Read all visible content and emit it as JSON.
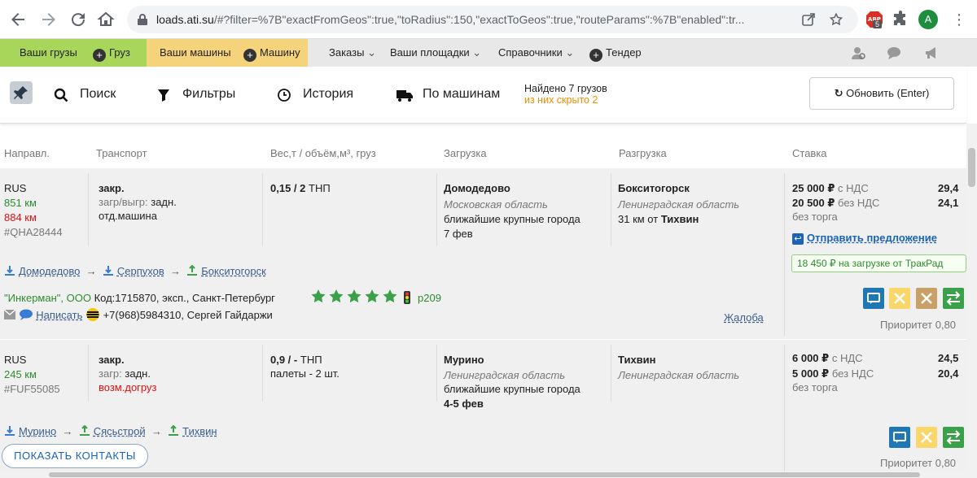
{
  "browser": {
    "url_host": "loads.ati.su",
    "url_rest": "/#?filter=%7B\"exactFromGeos\":true,\"toRadius\":150,\"exactToGeos\":true,\"routeParams\":%7B\"enabled\":tr...",
    "ext_badge": "5",
    "avatar_letter": "A"
  },
  "topmenu": {
    "my_cargo": "Ваши грузы",
    "add_cargo": "Груз",
    "my_trucks": "Ваши машины",
    "add_truck": "Машину",
    "orders": "Заказы",
    "platforms": "Ваши площадки",
    "directories": "Справочники",
    "tender": "Тендер"
  },
  "toolbar": {
    "search": "Поиск",
    "filters": "Фильтры",
    "history": "История",
    "by_trucks": "По машинам",
    "found": "Найдено 7 грузов",
    "hidden": "из них скрыто 2",
    "refresh": "Обновить (Enter)"
  },
  "columns": {
    "direction": "Направл.",
    "transport": "Транспорт",
    "weight": "Вес,т / объём,м³, груз",
    "loading": "Загрузка",
    "unloading": "Разгрузка",
    "rate": "Ставка"
  },
  "rows": [
    {
      "country": "RUS",
      "dist1": "851 км",
      "dist2": "884 км",
      "id": "#QHA28444",
      "body": "закр.",
      "load_label": "загр/выгр:",
      "load_value": "задн.",
      "extra": "отд.машина",
      "weight": "0,15 / 2",
      "cargo": "ТНП",
      "from_city": "Домодедово",
      "from_region": "Московская область",
      "from_near": "ближайшие крупные города",
      "from_date": "7 фев",
      "to_city": "Бокситогорск",
      "to_region": "Ленинградская область",
      "to_dist": "31 км от",
      "to_dist_city": "Тихвин",
      "rate_vat": "25 000 ₽",
      "rate_vat_label": "с НДС",
      "rate_novat": "20 500 ₽",
      "rate_novat_label": "без НДС",
      "no_bargain": "без торга",
      "rate_per_km1": "29,4",
      "rate_per_km2": "24,1",
      "send_offer": "Отправить предложение",
      "trakrad": "18 450 ₽ на загрузке от ТракРад",
      "route1": "Домодедово",
      "route2": "Серпухов",
      "route3": "Бокситогорск",
      "company": "\"Инкерман\", ООО",
      "company_info": "Код:1715870, эксп., Санкт-Петербург",
      "rating_stars": 5,
      "company_score": "р209",
      "write": "Написать",
      "phone": "+7(968)5984310, Сергей Гайдаржи",
      "complaint": "Жалоба",
      "priority": "Приоритет 0,80"
    },
    {
      "country": "RUS",
      "dist1": "245 км",
      "id": "#FUF55085",
      "body": "закр.",
      "load_label": "загр:",
      "load_value": "задн.",
      "extra": "возм.догруз",
      "weight": "0,9 / -",
      "cargo": "ТНП",
      "cargo2": "палеты - 2 шт.",
      "from_city": "Мурино",
      "from_region": "Ленинградская область",
      "from_near": "ближайшие крупные города",
      "from_date": "4-5 фев",
      "to_city": "Тихвин",
      "to_region": "Ленинградская область",
      "rate_vat": "6 000 ₽",
      "rate_vat_label": "с НДС",
      "rate_novat": "5 000 ₽",
      "rate_novat_label": "без НДС",
      "no_bargain": "без торга",
      "rate_per_km1": "24,5",
      "rate_per_km2": "20,4",
      "route1": "Мурино",
      "route2": "Сясьстрой",
      "route3": "Тихвин",
      "show_contacts": "ПОКАЗАТЬ КОНТАКТЫ",
      "priority": "Приоритет 0,80"
    }
  ],
  "icons": {
    "back": "arrow-left-icon",
    "forward": "arrow-right-icon",
    "reload": "reload-icon",
    "home": "home-icon",
    "pin": "pin-icon",
    "search": "magnifier-icon",
    "filter": "funnel-icon",
    "history": "clock-icon",
    "truck": "truck-icon"
  },
  "colors": {
    "menu_green": "#a8d65b",
    "menu_yellow": "#f5d37a",
    "accent_blue": "#1a63b5",
    "green": "#2e8b2e",
    "red": "#d11111",
    "orange": "#f08c00"
  }
}
